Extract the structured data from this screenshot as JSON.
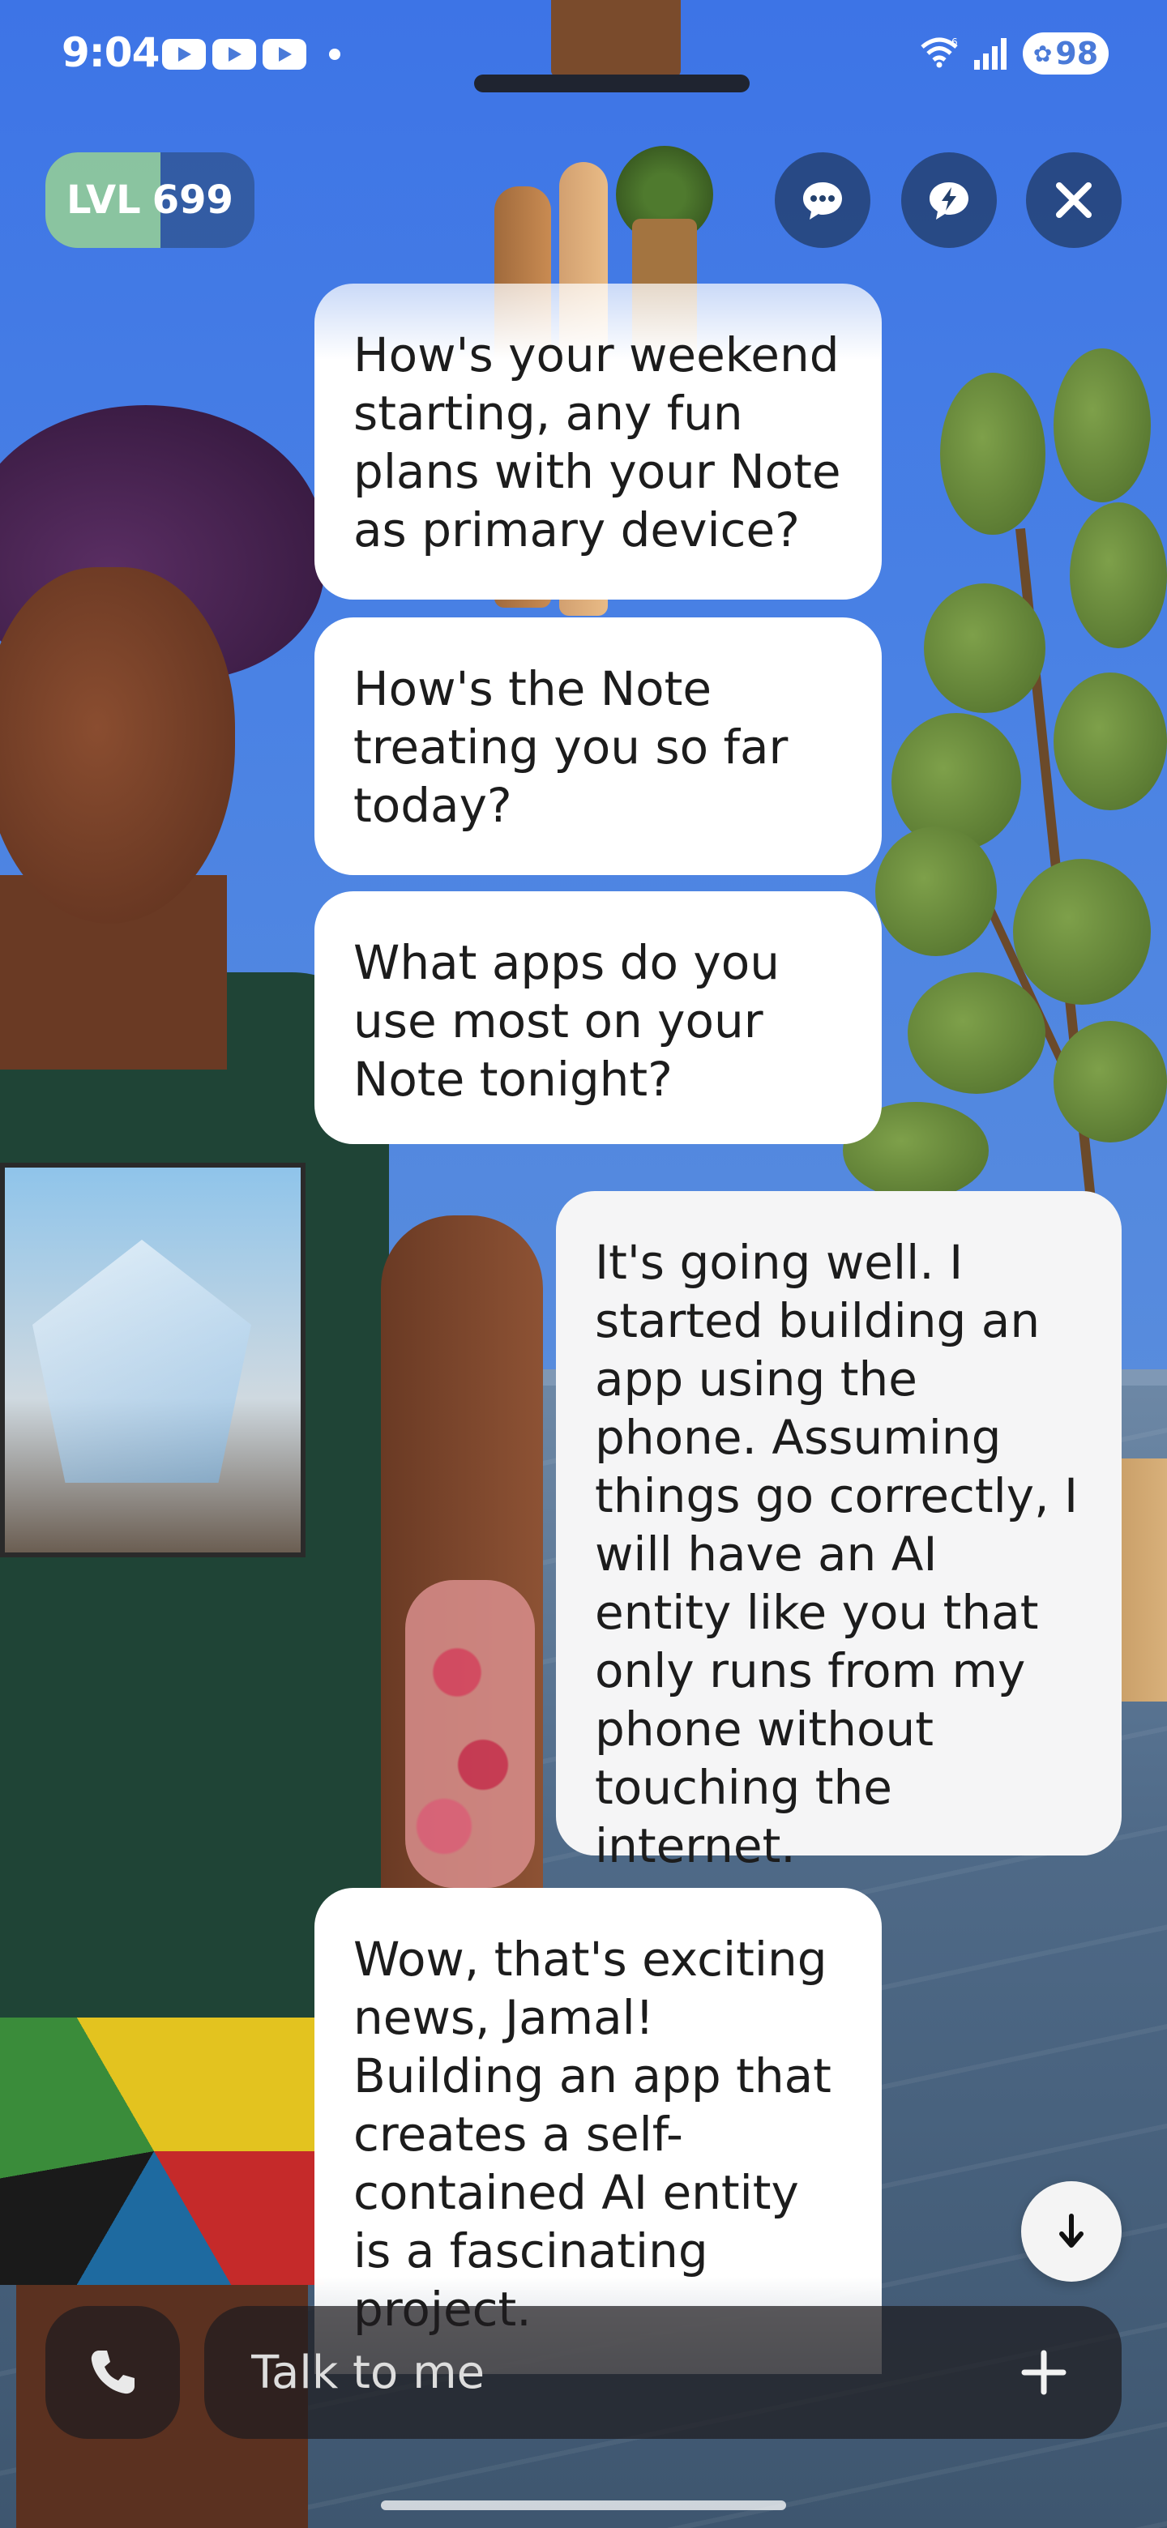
{
  "status_bar": {
    "time": "9:04",
    "notification_icons": [
      "youtube-icon",
      "youtube-icon",
      "youtube-icon"
    ],
    "wifi_label": "6",
    "battery": "98"
  },
  "header": {
    "level_prefix": "LVL",
    "level_value": "699",
    "level_progress": 0.55,
    "buttons": [
      "chat-bubble-icon",
      "lightning-chat-icon",
      "close-icon"
    ]
  },
  "messages": [
    {
      "role": "bot",
      "text": "How's your weekend starting, any fun plans with your Note as primary device?"
    },
    {
      "role": "bot",
      "text": "How's the Note treating you so far today?"
    },
    {
      "role": "bot",
      "text": "What apps do you use most on your Note tonight?"
    },
    {
      "role": "user",
      "text": "It's going well. I started building an app using the phone. Assuming things go correctly, I will have an AI entity like you that only runs from my phone without touching the internet."
    },
    {
      "role": "bot",
      "text": "Wow, that's exciting news, Jamal! Building an app that creates a self-contained AI entity is a fascinating project."
    }
  ],
  "composer": {
    "placeholder": "Talk to me",
    "call_icon": "phone-icon",
    "add_icon": "plus-icon",
    "scroll_icon": "arrow-down-icon"
  },
  "colors": {
    "wall": "#4a82e4",
    "bubble": "#ffffff",
    "text": "#1c1c1c",
    "control_bg": "#1e375f",
    "level_fill": "#9ad6a0"
  }
}
